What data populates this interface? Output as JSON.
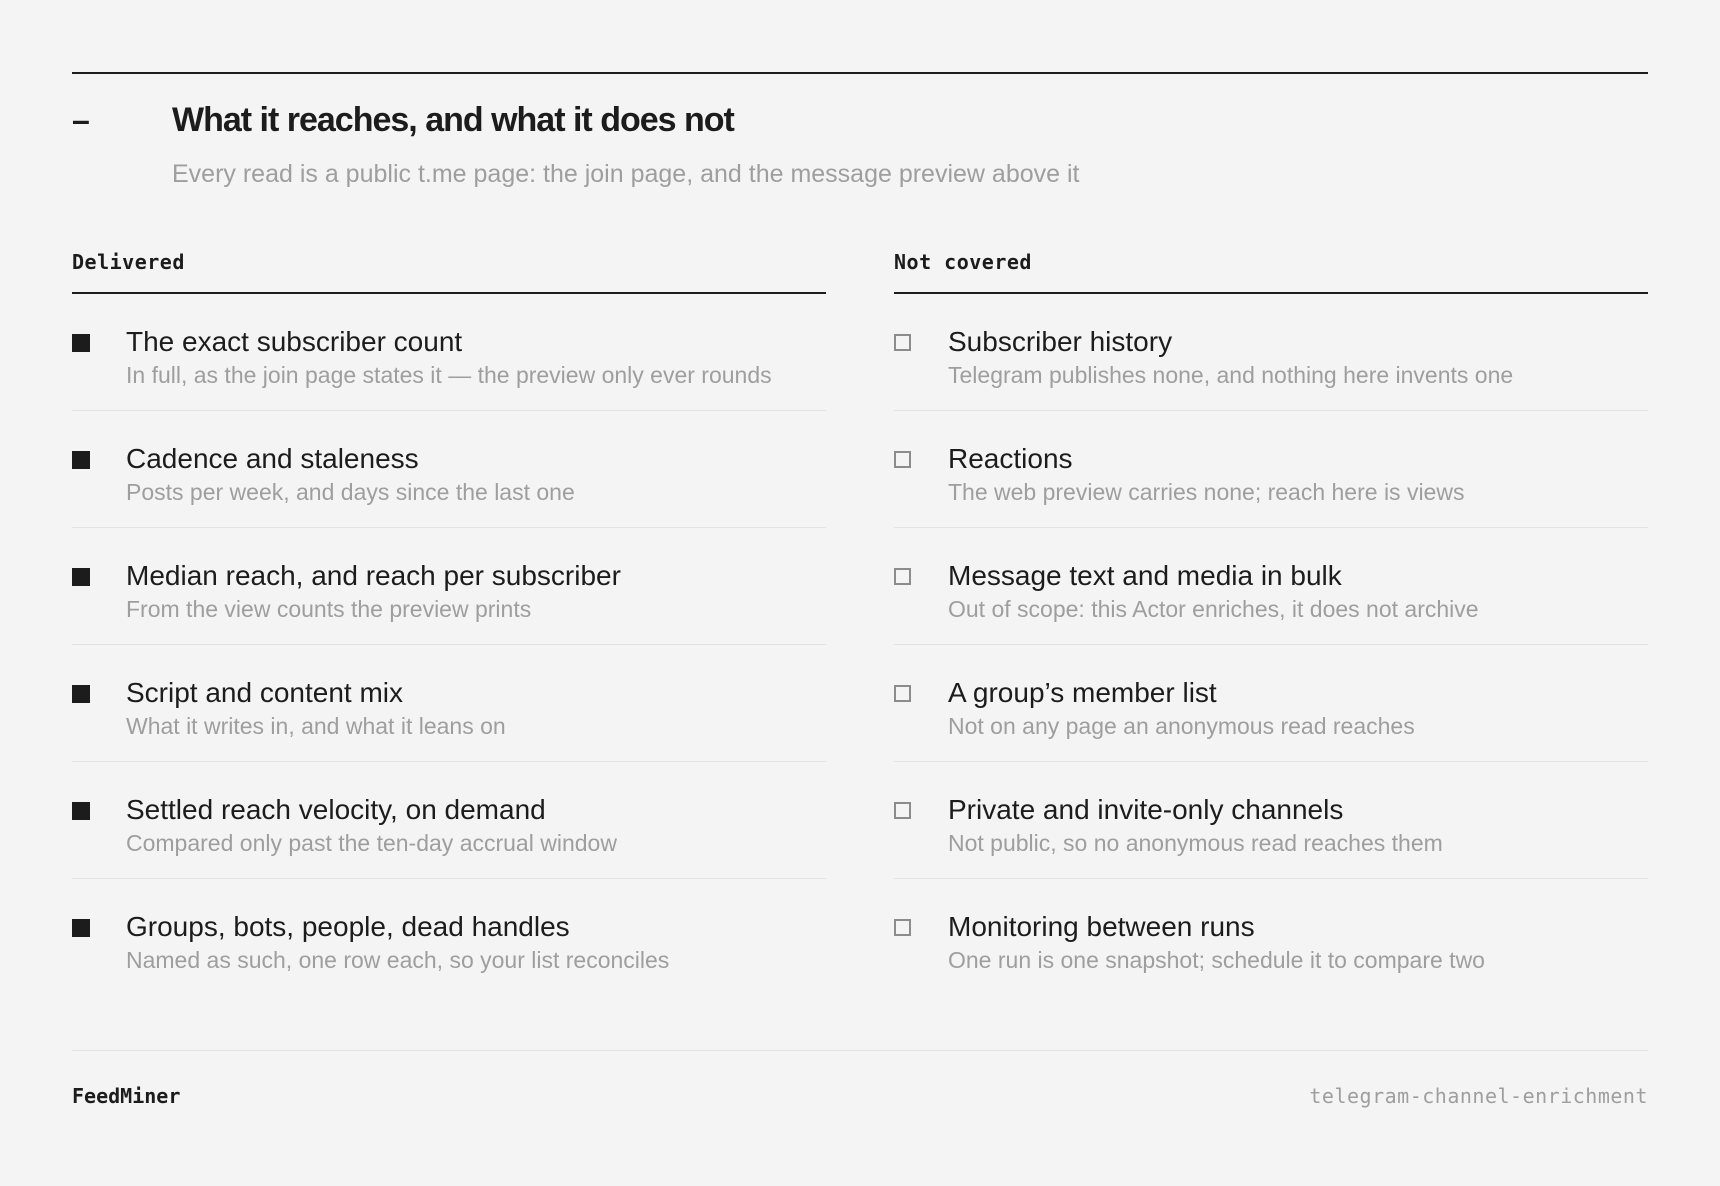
{
  "header": {
    "dash": "–",
    "title": "What it reaches, and what it does not",
    "subtitle": "Every read is a public t.me page: the join page, and the message preview above it"
  },
  "delivered": {
    "heading": "Delivered",
    "items": [
      {
        "title": "The exact subscriber count",
        "desc": "In full, as the join page states it — the preview only ever rounds"
      },
      {
        "title": "Cadence and staleness",
        "desc": "Posts per week, and days since the last one"
      },
      {
        "title": "Median reach, and reach per subscriber",
        "desc": "From the view counts the preview prints"
      },
      {
        "title": "Script and content mix",
        "desc": "What it writes in, and what it leans on"
      },
      {
        "title": "Settled reach velocity, on demand",
        "desc": "Compared only past the ten-day accrual window"
      },
      {
        "title": "Groups, bots, people, dead handles",
        "desc": "Named as such, one row each, so your list reconciles"
      }
    ]
  },
  "not_covered": {
    "heading": "Not covered",
    "items": [
      {
        "title": "Subscriber history",
        "desc": "Telegram publishes none, and nothing here invents one"
      },
      {
        "title": "Reactions",
        "desc": "The web preview carries none; reach here is views"
      },
      {
        "title": "Message text and media in bulk",
        "desc": "Out of scope: this Actor enriches, it does not archive"
      },
      {
        "title": "A group’s member list",
        "desc": "Not on any page an anonymous read reaches"
      },
      {
        "title": "Private and invite-only channels",
        "desc": "Not public, so no anonymous read reaches them"
      },
      {
        "title": "Monitoring between runs",
        "desc": "One run is one snapshot; schedule it to compare two"
      }
    ]
  },
  "footer": {
    "brand": "FeedMiner",
    "slug": "telegram-channel-enrichment"
  },
  "icons": {
    "delivered_marker": "filled-square-icon",
    "not_covered_marker": "empty-square-icon"
  },
  "colors": {
    "ink": "#1c1c1c",
    "muted": "#9e9e9e",
    "background": "#f4f4f4",
    "divider": "#e2e2e2"
  }
}
